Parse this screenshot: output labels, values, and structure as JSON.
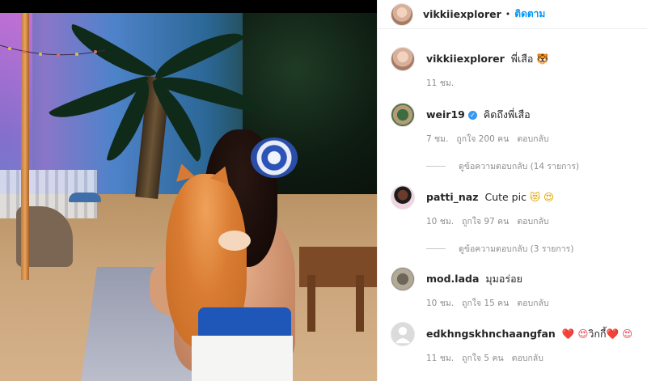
{
  "post": {
    "author": "vikkiiexplorer",
    "follow_label": "ติดตาม",
    "dot": "•"
  },
  "comments": [
    {
      "username": "vikkiiexplorer",
      "text": "พี่เสือ",
      "emoji": "🐯",
      "time": "11 ชม.",
      "likes": "",
      "reply": ""
    },
    {
      "username": "weir19",
      "verified": true,
      "text": "คิดถึงพี่เสือ",
      "time": "7 ชม.",
      "likes": "ถูกใจ 200 คน",
      "reply": "ตอบกลับ",
      "view_replies": "ดูข้อความตอบกลับ (14 รายการ)"
    },
    {
      "username": "patti_naz",
      "text": "Cute pic",
      "emoji": "😻 😍",
      "time": "10 ชม.",
      "likes": "ถูกใจ 97 คน",
      "reply": "ตอบกลับ",
      "view_replies": "ดูข้อความตอบกลับ (3 รายการ)"
    },
    {
      "username": "mod.lada",
      "text": "มุมอร่อย",
      "time": "10 ชม.",
      "likes": "ถูกใจ 15 คน",
      "reply": "ตอบกลับ"
    },
    {
      "username": "edkhngskhnchaangfan",
      "text_before": "❤️ 😍",
      "text": "วิกกี้",
      "text_after": "❤️ 😍",
      "time": "11 ชม.",
      "likes": "ถูกใจ 5 คน",
      "reply": "ตอบกลับ"
    }
  ],
  "colors": {
    "follow_blue": "#0095f6",
    "meta_gray": "#8e8e8e",
    "text": "#262626",
    "verified_blue": "#3897f0"
  }
}
